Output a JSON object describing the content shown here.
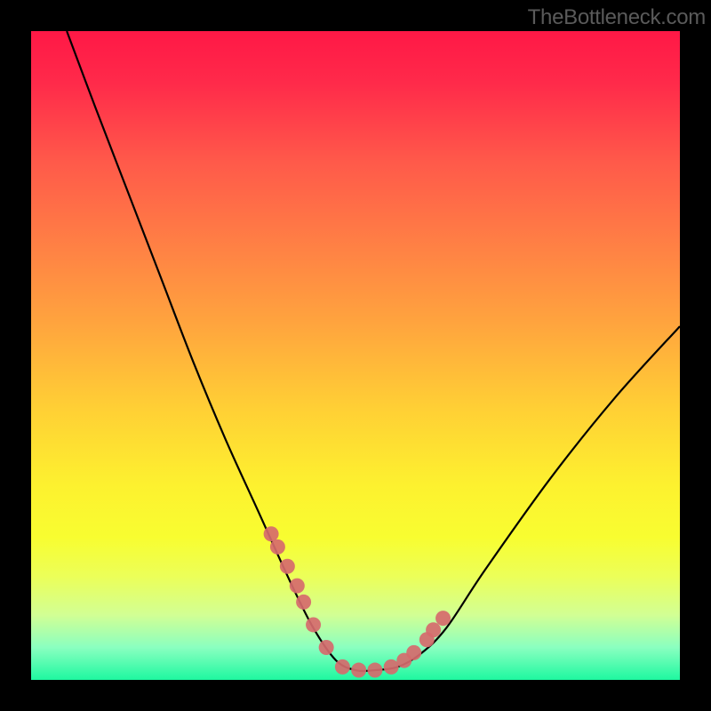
{
  "watermark": "TheBottleneck.com",
  "chart_data": {
    "type": "line",
    "title": "",
    "xlabel": "",
    "ylabel": "",
    "xlim": [
      0,
      1
    ],
    "ylim": [
      0,
      1
    ],
    "series": [
      {
        "name": "bottleneck-curve",
        "color": "#000000",
        "x": [
          0.055,
          0.1,
          0.15,
          0.2,
          0.25,
          0.3,
          0.35,
          0.4,
          0.435,
          0.47,
          0.5,
          0.53,
          0.565,
          0.6,
          0.64,
          0.7,
          0.8,
          0.9,
          1.0
        ],
        "y": [
          1.0,
          0.88,
          0.75,
          0.62,
          0.49,
          0.37,
          0.26,
          0.15,
          0.08,
          0.03,
          0.015,
          0.015,
          0.02,
          0.04,
          0.08,
          0.17,
          0.31,
          0.435,
          0.545
        ]
      }
    ],
    "markers": {
      "name": "highlight-dots",
      "color": "#d66a6c",
      "x": [
        0.37,
        0.38,
        0.395,
        0.41,
        0.42,
        0.435,
        0.455,
        0.48,
        0.505,
        0.53,
        0.555,
        0.575,
        0.59,
        0.61,
        0.62,
        0.635
      ],
      "y": [
        0.225,
        0.205,
        0.175,
        0.145,
        0.12,
        0.085,
        0.05,
        0.02,
        0.015,
        0.015,
        0.02,
        0.03,
        0.042,
        0.062,
        0.077,
        0.095
      ]
    }
  }
}
